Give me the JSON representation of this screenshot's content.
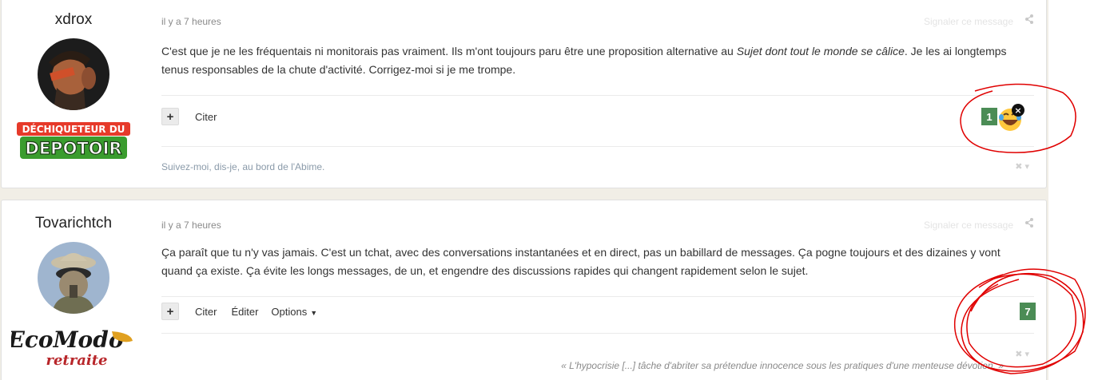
{
  "posts": [
    {
      "author": "xdrox",
      "time": "il y a 7 heures",
      "report": "Signaler ce message",
      "text_before": "C'est que je ne les fréquentais ni monitorais pas vraiment. Ils m'ont toujours paru être une proposition alternative au ",
      "text_italic": "Sujet dont tout le monde se câlice",
      "text_after": ". Je les ai longtemps tenus responsables de la chute d'activité. Corrigez-moi si je me trompe.",
      "actions": [
        "Citer"
      ],
      "reaction_count": "1",
      "signature": "Suivez-moi, dis-je, au bord de l'Abime.",
      "rank_lines": [
        "DÉCHIQUETEUR DU",
        "DEPOTOIR"
      ]
    },
    {
      "author": "Tovarichtch",
      "time": "il y a 7 heures",
      "report": "Signaler ce message",
      "text": "Ça paraît que tu n'y vas jamais. C'est un tchat, avec des conversations instantanées et en direct, pas un babillard de messages. Ça pogne toujours et des dizaines y vont quand ça existe. Ça évite les longs messages, de un, et engendre des discussions rapides qui changent rapidement selon le sujet.",
      "actions": [
        "Citer",
        "Éditer",
        "Options"
      ],
      "reaction_count": "7",
      "signature": "« L'hypocrisie [...] tâche d'abriter sa prétendue innocence sous les pratiques d'une menteuse dévotion. »",
      "rank_lines": [
        "EcoModo",
        "retraite"
      ]
    }
  ],
  "icons": {
    "plus": "+",
    "share": "share-icon",
    "close": "×",
    "reaction": "laughing-face-icon"
  },
  "colors": {
    "reaction_badge": "#4b8c55",
    "annotation": "#e00000"
  }
}
